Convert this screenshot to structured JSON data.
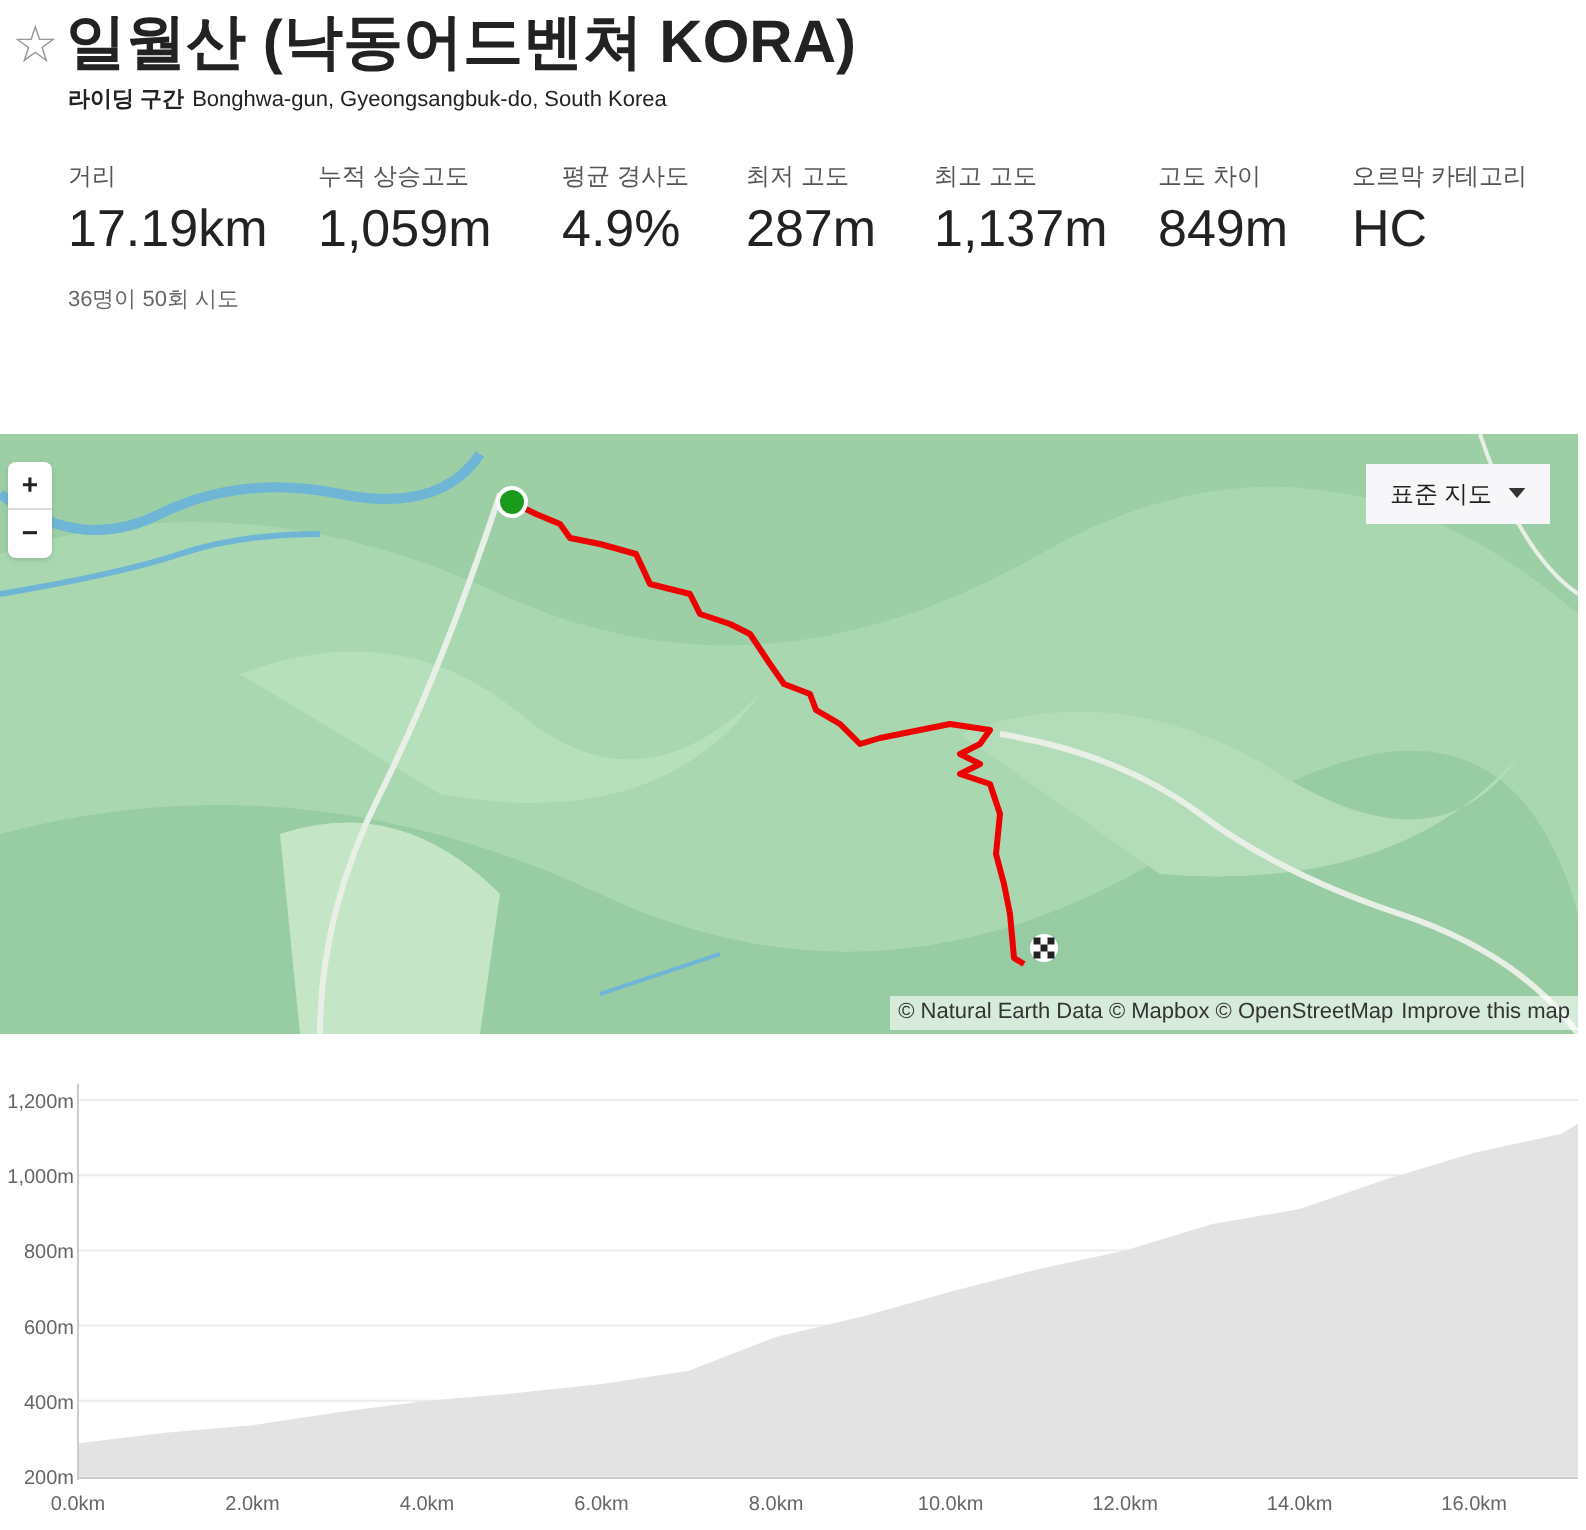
{
  "segment": {
    "starred": false,
    "star": "☆",
    "title": "일월산 (낙동어드벤쳐 KORA)",
    "type_label": "라이딩 구간",
    "location": "Bonghwa-gun, Gyeongsangbuk-do, South Korea"
  },
  "stats": [
    {
      "label": "거리",
      "value": "17.19km"
    },
    {
      "label": "누적 상승고도",
      "value": "1,059m"
    },
    {
      "label": "평균 경사도",
      "value": "4.9%"
    },
    {
      "label": "최저 고도",
      "value": "287m"
    },
    {
      "label": "최고 고도",
      "value": "1,137m"
    },
    {
      "label": "고도 차이",
      "value": "849m"
    },
    {
      "label": "오르막 카테고리",
      "value": "HC"
    }
  ],
  "attempts": "36명이 50회 시도",
  "map": {
    "kind": "picture",
    "zoom_in": "+",
    "zoom_out": "−",
    "style_selector": "표준 지도",
    "attribution": "© Natural Earth Data © Mapbox © OpenStreetMap",
    "improve_link": "Improve this map"
  },
  "elevation": {
    "chart_data": {
      "type": "area",
      "x": [
        0,
        1,
        2,
        3,
        4,
        5,
        6,
        7,
        8,
        9,
        10,
        11,
        12,
        13,
        14,
        15,
        16,
        17,
        17.19
      ],
      "grid": true,
      "series": [
        {
          "color": "#e3e3e3",
          "values": [
            287,
            315,
            335,
            370,
            400,
            420,
            445,
            480,
            570,
            625,
            690,
            750,
            800,
            870,
            910,
            990,
            1060,
            1110,
            1137
          ]
        }
      ],
      "xlim": [
        0,
        17.19
      ],
      "ylim": [
        200,
        1250
      ],
      "xticks": [
        {
          "value": 0,
          "label": "0.0km"
        },
        {
          "value": 2,
          "label": "2.0km"
        },
        {
          "value": 4,
          "label": "4.0km"
        },
        {
          "value": 6,
          "label": "6.0km"
        },
        {
          "value": 8,
          "label": "8.0km"
        },
        {
          "value": 10,
          "label": "10.0km"
        },
        {
          "value": 12,
          "label": "12.0km"
        },
        {
          "value": 14,
          "label": "14.0km"
        },
        {
          "value": 16,
          "label": "16.0km"
        }
      ],
      "yticks": [
        {
          "value": 200,
          "label": "200m"
        },
        {
          "value": 400,
          "label": "400m"
        },
        {
          "value": 600,
          "label": "600m"
        },
        {
          "value": 800,
          "label": "800m"
        },
        {
          "value": 1000,
          "label": "1,000m"
        },
        {
          "value": 1200,
          "label": "1,200m"
        }
      ]
    }
  }
}
